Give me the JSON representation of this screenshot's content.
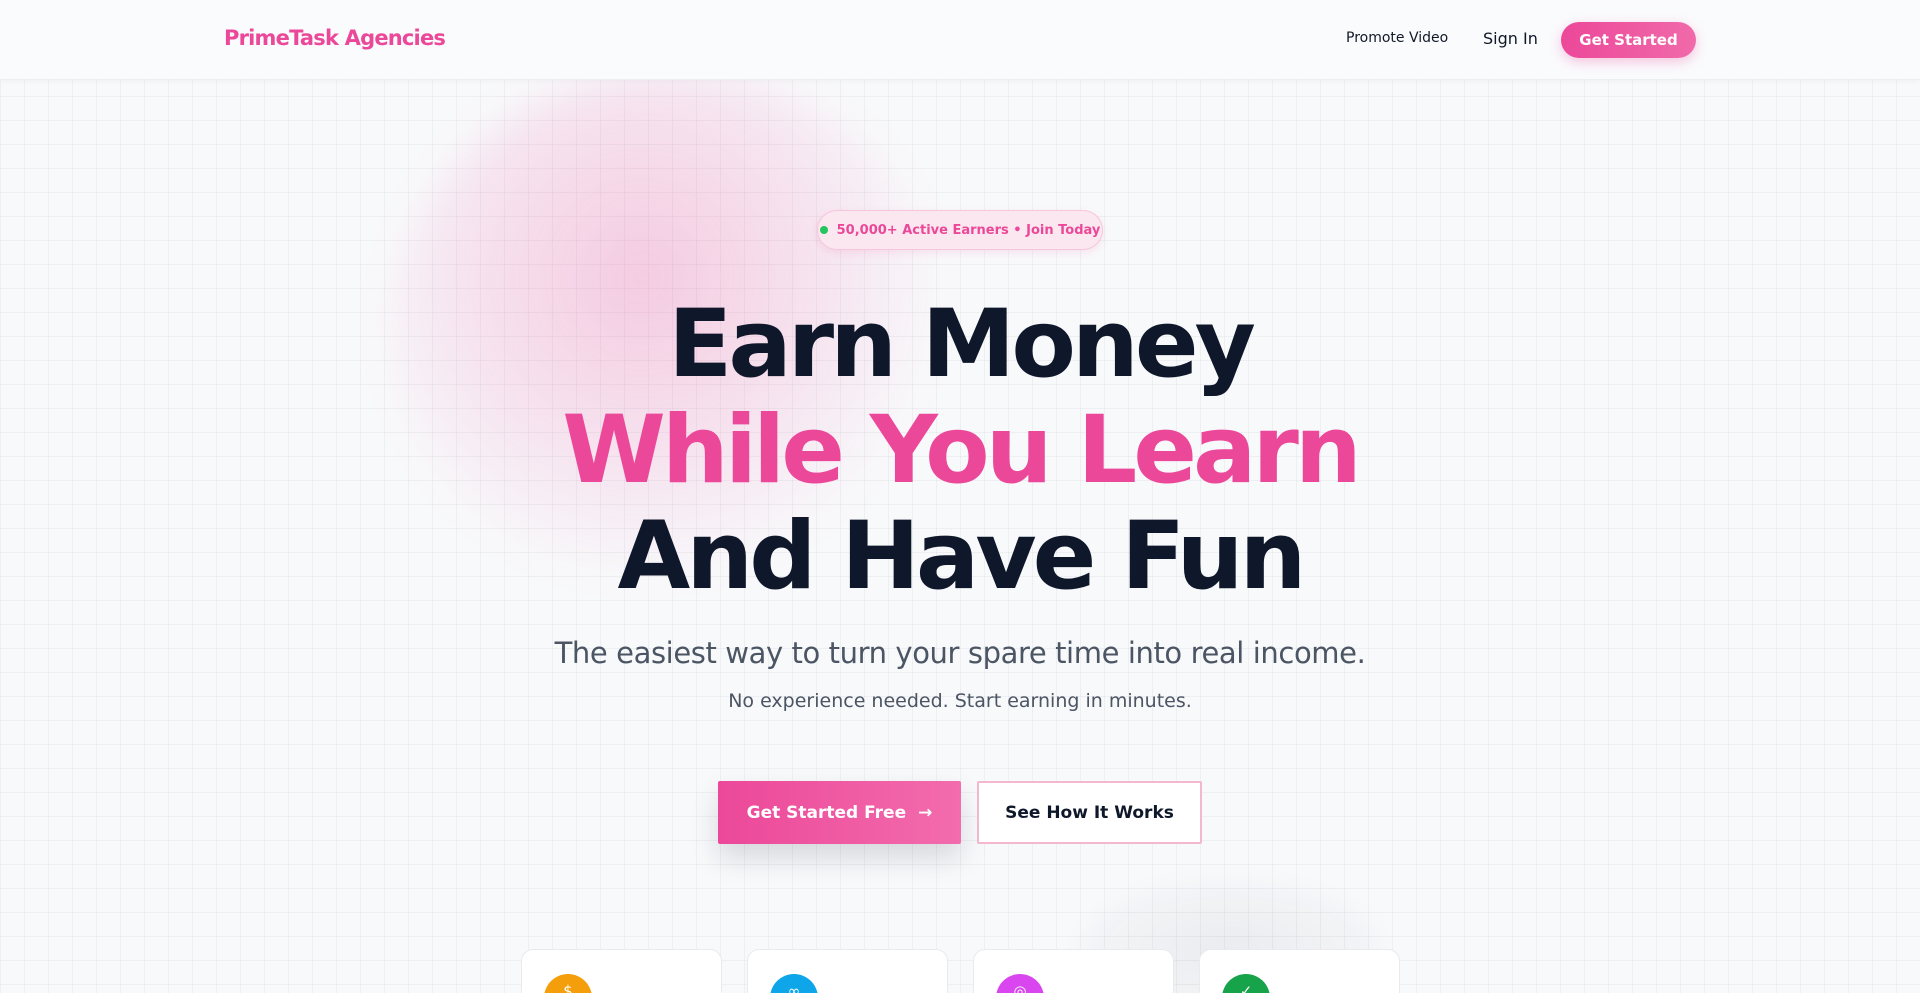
{
  "header": {
    "logo": "PrimeTask Agencies",
    "nav": {
      "promote": "Promote Video",
      "signin": "Sign In"
    },
    "cta": "Get Started"
  },
  "hero": {
    "badge": "50,000+ Active Earners • Join Today",
    "headline": {
      "line1": "Earn Money",
      "line2": "While You Learn",
      "line3": "And Have Fun"
    },
    "subtitle": "The easiest way to turn your spare time into real income.",
    "subtitle2": "No experience needed. Start earning in minutes.",
    "primary_cta": "Get Started Free",
    "primary_cta_arrow": "→",
    "secondary_cta": "See How It Works"
  },
  "features": [
    {
      "icon": "coin-icon",
      "color": "#f59e0b",
      "glyph": "$"
    },
    {
      "icon": "people-icon",
      "color": "#0ea5e9",
      "glyph": "∞"
    },
    {
      "icon": "target-icon",
      "color": "#d946ef",
      "glyph": "◎"
    },
    {
      "icon": "check-circle-icon",
      "color": "#16a34a",
      "glyph": "✓"
    }
  ],
  "colors": {
    "accent": "#ec4899",
    "heading": "#0f172a",
    "body": "#4b5563",
    "online_dot": "#22c55e"
  }
}
